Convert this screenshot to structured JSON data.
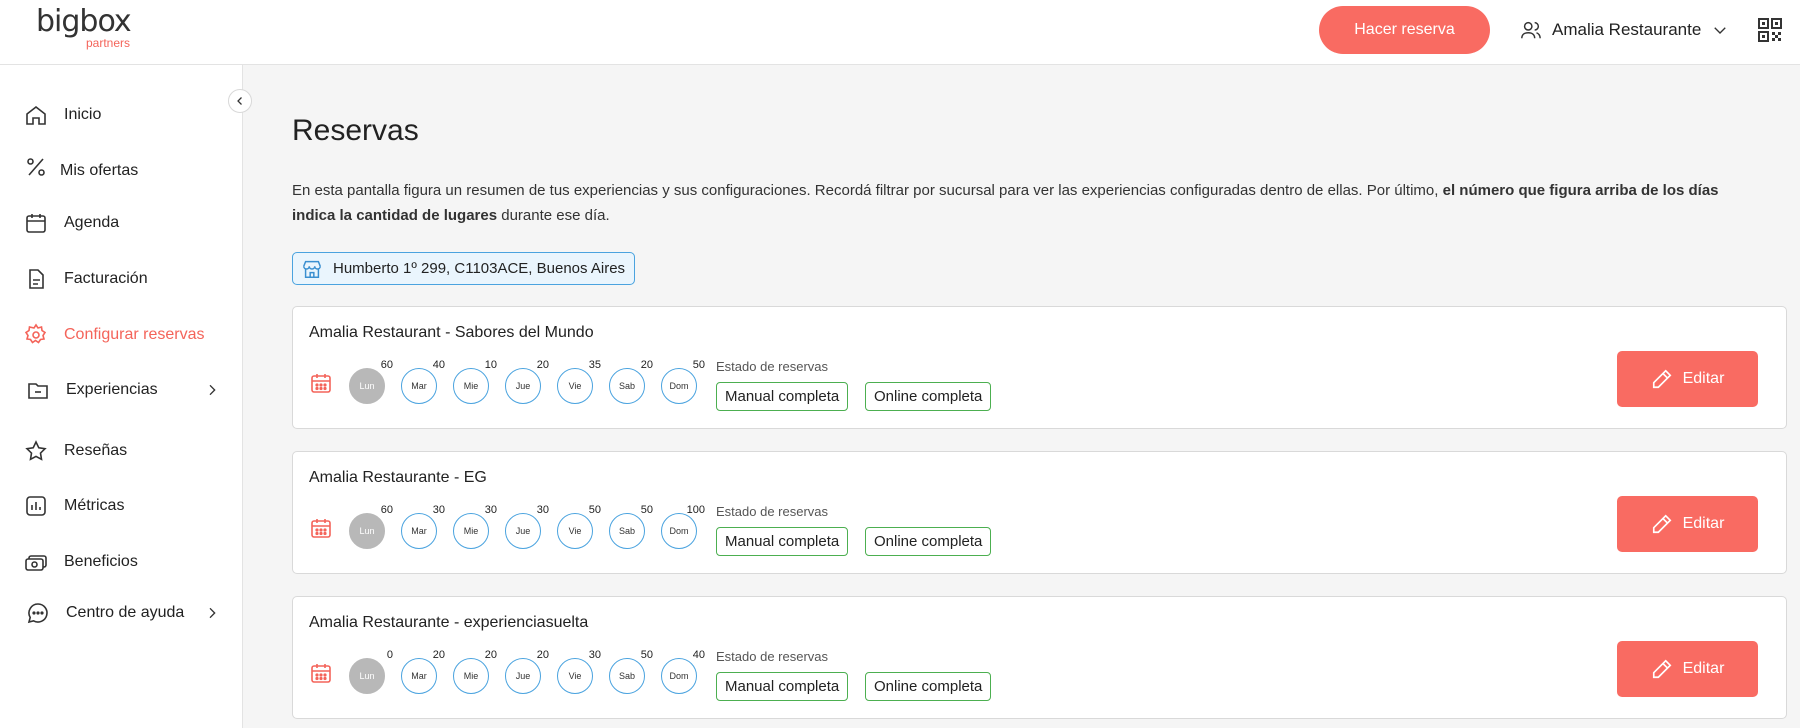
{
  "header": {
    "logo_word": "bigbox",
    "logo_sub": "partners",
    "primary_button": "Hacer reserva",
    "user_name": "Amalia Restaurante",
    "icons": {
      "user": "users-icon",
      "dropdown": "chevron-down-icon",
      "qr": "qr-code-icon"
    }
  },
  "sidebar": {
    "items": [
      {
        "label": "Inicio",
        "icon": "home-icon"
      },
      {
        "label": "Mis ofertas",
        "icon": "percent-icon"
      },
      {
        "label": "Agenda",
        "icon": "calendar-icon"
      },
      {
        "label": "Facturación",
        "icon": "document-icon"
      },
      {
        "label": "Configurar reservas",
        "icon": "gear-icon",
        "active": true
      },
      {
        "label": "Experiencias",
        "icon": "folder-icon",
        "has_submenu": true
      },
      {
        "label": "Reseñas",
        "icon": "star-icon"
      },
      {
        "label": "Métricas",
        "icon": "bar-chart-icon"
      },
      {
        "label": "Beneficios",
        "icon": "money-icon"
      },
      {
        "label": "Centro de ayuda",
        "icon": "chat-bubble-icon",
        "has_submenu": true
      }
    ]
  },
  "main": {
    "title": "Reservas",
    "description_part1": "En esta pantalla figura un resumen de tus experiencias y sus configuraciones. Recordá filtrar por sucursal para ver las experiencias configuradas dentro de ellas. Por último, ",
    "description_bold": "el número que figura arriba de los días indica la cantidad de lugares",
    "description_part2": " durante ese día.",
    "branch": "Humberto 1º 299, C1103ACE, Buenos Aires",
    "estado_label": "Estado de reservas",
    "edit_label": "Editar",
    "cards": [
      {
        "title": "Amalia Restaurant - Sabores del Mundo",
        "days": [
          {
            "label": "Lun",
            "count": "60",
            "off": true
          },
          {
            "label": "Mar",
            "count": "40"
          },
          {
            "label": "Mie",
            "count": "10"
          },
          {
            "label": "Jue",
            "count": "20"
          },
          {
            "label": "Vie",
            "count": "35"
          },
          {
            "label": "Sab",
            "count": "20"
          },
          {
            "label": "Dom",
            "count": "50"
          }
        ],
        "statuses": [
          "Manual completa",
          "Online completa"
        ]
      },
      {
        "title": "Amalia Restaurante - EG",
        "days": [
          {
            "label": "Lun",
            "count": "60",
            "off": true
          },
          {
            "label": "Mar",
            "count": "30"
          },
          {
            "label": "Mie",
            "count": "30"
          },
          {
            "label": "Jue",
            "count": "30"
          },
          {
            "label": "Vie",
            "count": "50"
          },
          {
            "label": "Sab",
            "count": "50"
          },
          {
            "label": "Dom",
            "count": "100"
          }
        ],
        "statuses": [
          "Manual completa",
          "Online completa"
        ]
      },
      {
        "title": "Amalia Restaurante - experienciasuelta",
        "days": [
          {
            "label": "Lun",
            "count": "0",
            "off": true
          },
          {
            "label": "Mar",
            "count": "20"
          },
          {
            "label": "Mie",
            "count": "20"
          },
          {
            "label": "Jue",
            "count": "20"
          },
          {
            "label": "Vie",
            "count": "30"
          },
          {
            "label": "Sab",
            "count": "50"
          },
          {
            "label": "Dom",
            "count": "40"
          }
        ],
        "statuses": [
          "Manual completa",
          "Online completa"
        ]
      }
    ]
  },
  "colors": {
    "accent": "#f96b62",
    "blue": "#4aa3df",
    "green": "#4caf50"
  }
}
